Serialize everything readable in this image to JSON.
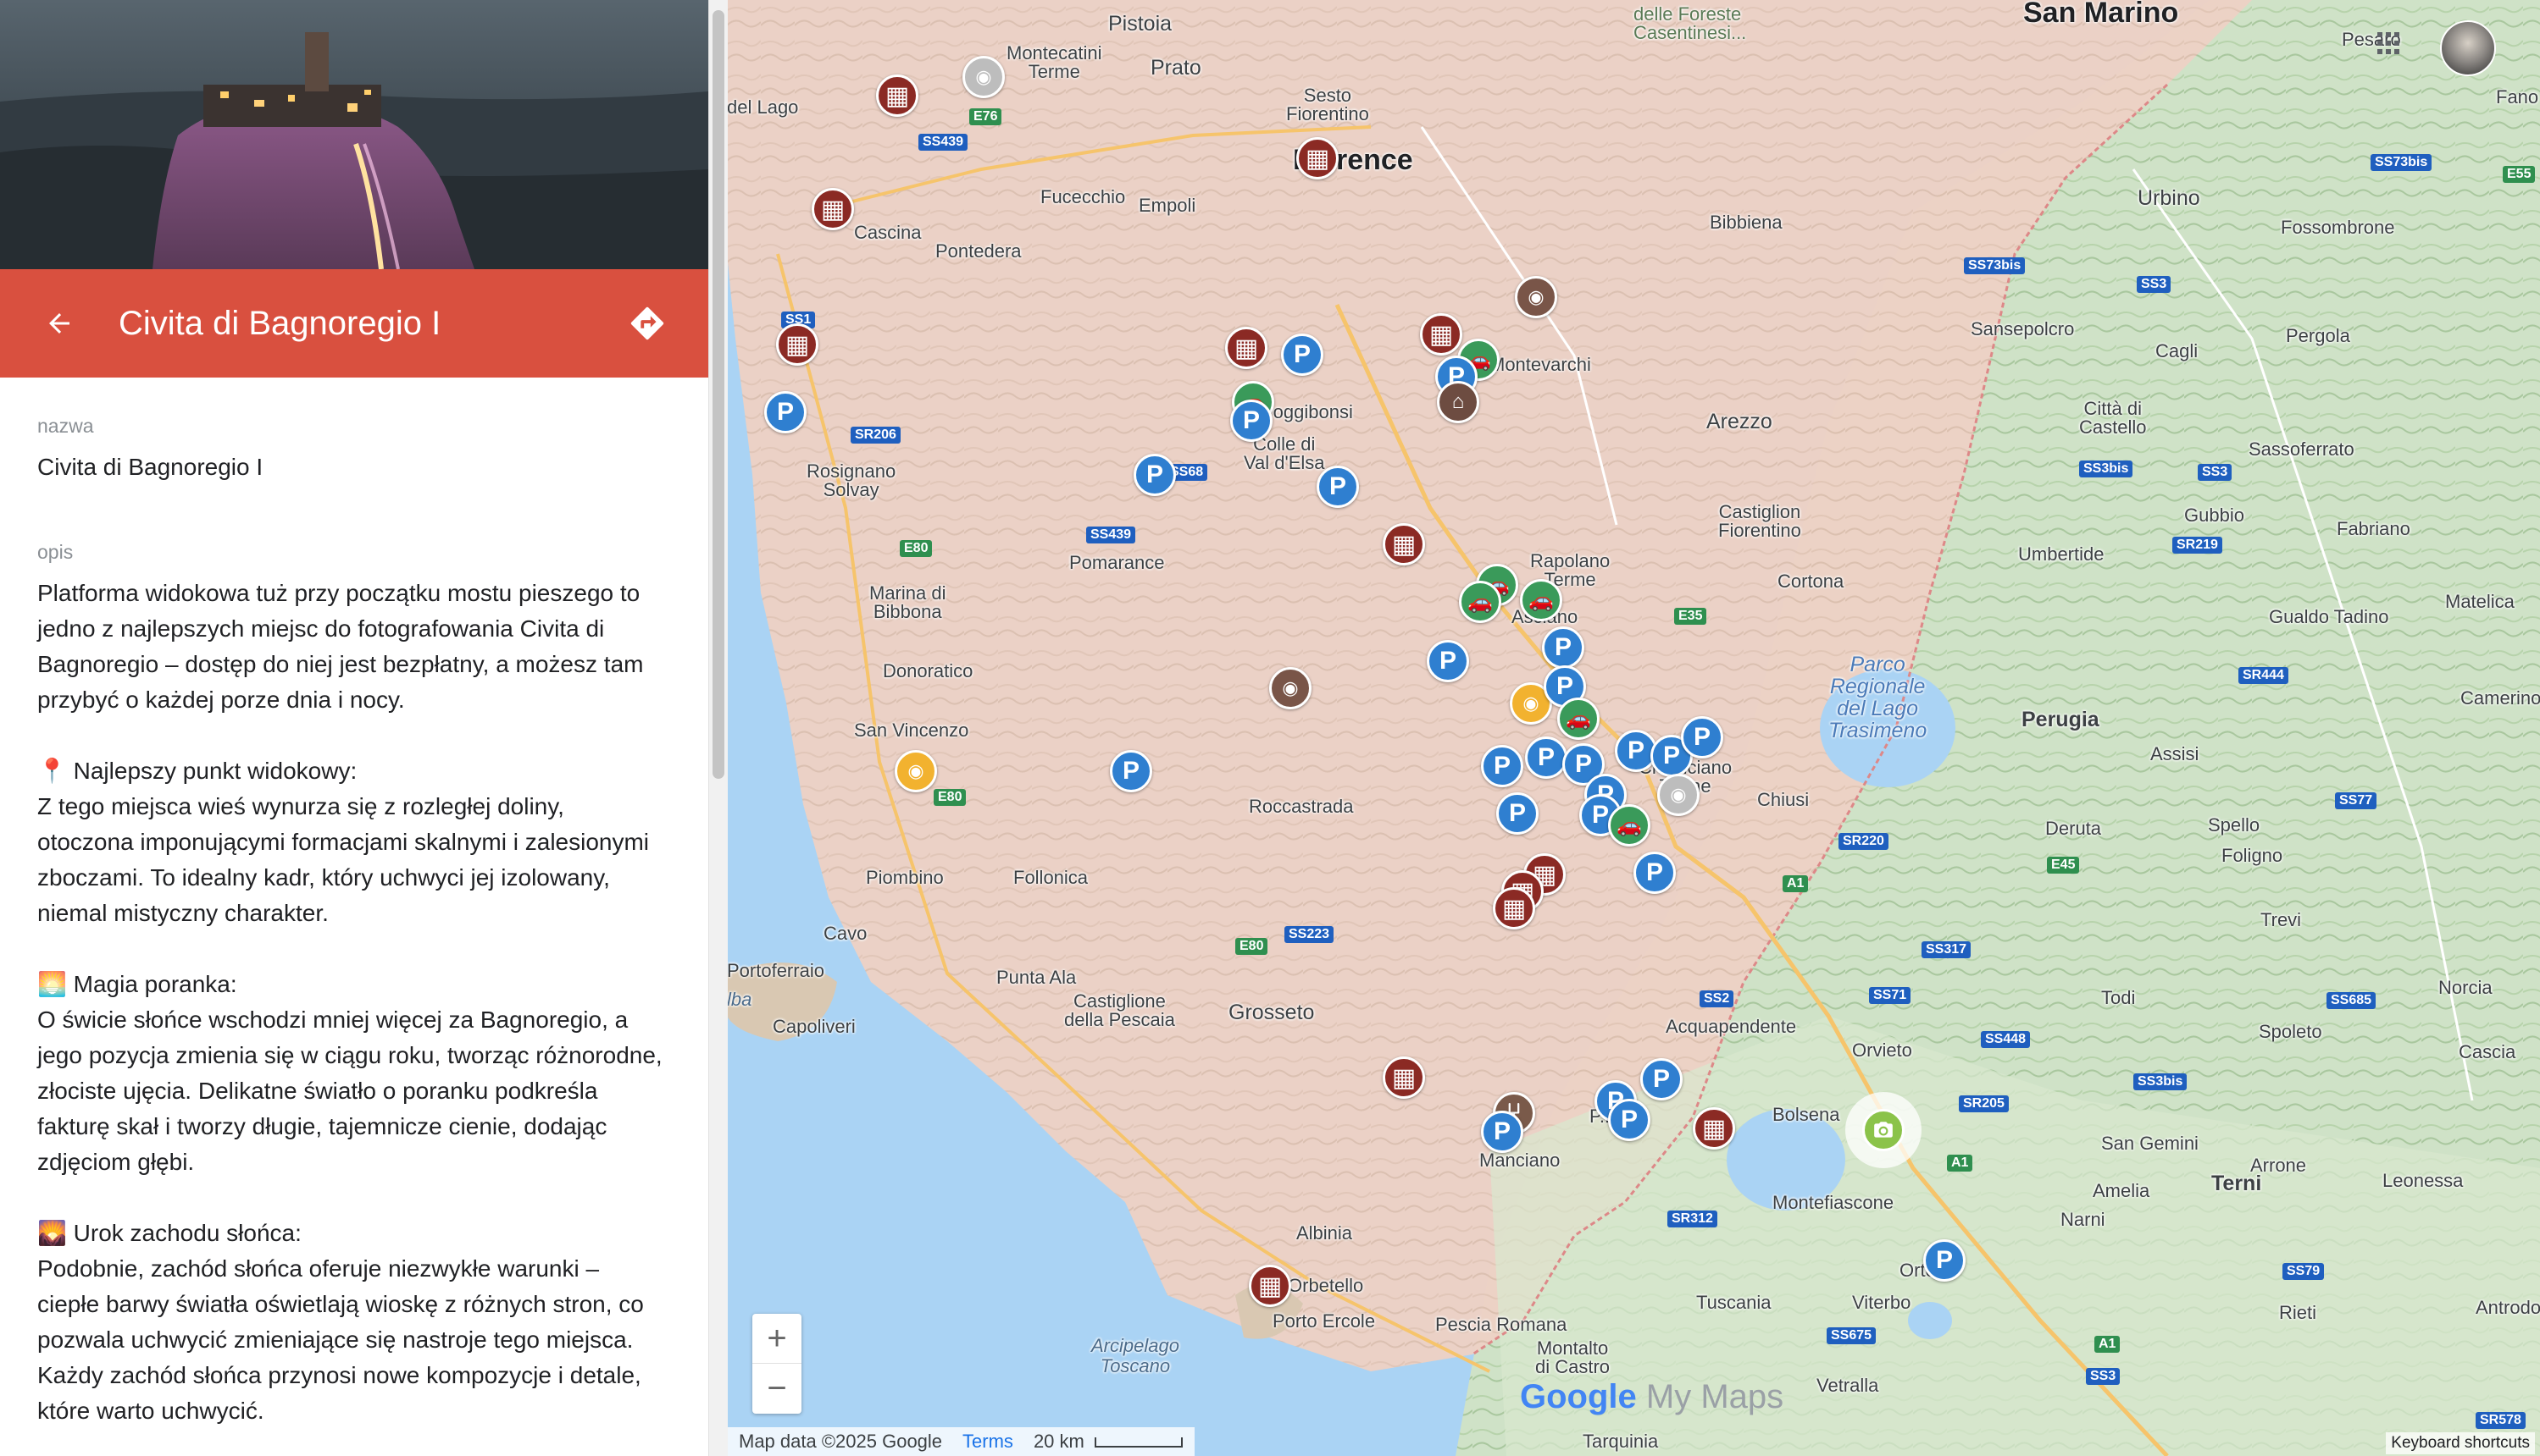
{
  "panel": {
    "title": "Civita di Bagnoregio I",
    "back_icon": "arrow-left-icon",
    "directions_icon": "directions-icon",
    "fields": {
      "name_label": "nazwa",
      "name_value": "Civita di Bagnoregio I",
      "desc_label": "opis",
      "desc_value": "Platforma widokowa tuż przy początku mostu pieszego to jedno z najlepszych miejsc do fotografowania Civita di Bagnoregio – dostęp do niej jest bezpłatny, a możesz tam przybyć o każdej porze dnia i nocy.\n\n📍 Najlepszy punkt widokowy:\nZ tego miejsca wieś wynurza się z rozległej doliny, otoczona imponującymi formacjami skalnymi i zalesionymi zboczami. To idealny kadr, który uchwyci jej izolowany, niemal mistyczny charakter.\n\n🌅 Magia poranka:\nO świcie słońce wschodzi mniej więcej za Bagnoregio, a jego pozycja zmienia się w ciągu roku, tworząc różnorodne, złociste ujęcia. Delikatne światło o poranku podkreśla fakturę skał i tworzy długie, tajemnicze cienie, dodając zdjęciom głębi.\n\n🌄 Urok zachodu słońca:\nPodobnie, zachód słońca oferuje niezwykłe warunki – ciepłe barwy światła oświetlają wioskę z różnych stron, co pozwala uchwycić zmieniające się nastroje tego miejsca. Każdy zachód słońca przynosi nowe kompozycje i detale, które warto uchwycić."
    },
    "colors": {
      "header": "#d9503f"
    }
  },
  "map": {
    "places": {
      "san_marino": "San Marino",
      "pistoia": "Pistoia",
      "prato": "Prato",
      "firenze": "Florence",
      "sesto": "Sesto\nFiorentino",
      "montecatini": "Montecatini\nTerme",
      "del_lago": "del Lago",
      "fucecchio": "Fucecchio",
      "empoli": "Empoli",
      "cascina": "Cascina",
      "pontedera": "Pontedera",
      "bibbiena": "Bibbiena",
      "foreste": "delle Foreste\nCasentinesi...",
      "urbino": "Urbino",
      "fano": "Fano",
      "pesaro": "Pesaro",
      "fossombrone": "Fossombrone",
      "pergola": "Pergola",
      "cagli": "Cagli",
      "sansepolcro": "Sansepolcro",
      "citta_castello": "Città di\nCastello",
      "sassoferrato": "Sassoferrato",
      "montevarchi": "Montevarchi",
      "arezzo": "Arezzo",
      "poggibonsi": "Poggibonsi",
      "colle": "Colle di\nVal d'Elsa",
      "rosignano": "Rosignano\nSolvay",
      "pomarance": "Pomarance",
      "castiglion": "Castiglion\nFiorentino",
      "rapolano": "Rapolano\nTerme",
      "cortona": "Cortona",
      "gubbio": "Gubbio",
      "umbertide": "Umbertide",
      "fabriano": "Fabriano",
      "gualdo": "Gualdo Tadino",
      "matelica": "Matelica",
      "marina_bibbona": "Marina di\nBibbona",
      "donoratico": "Donoratico",
      "asciano": "Asciano",
      "parco": "Parco\nRegionale\ndel Lago\nTrasimeno",
      "perugia": "Perugia",
      "assisi": "Assisi",
      "camerino": "Camerino",
      "san_vincenzo": "San Vincenzo",
      "roccastrada": "Roccastrada",
      "chiusi": "Chiusi",
      "deruta": "Deruta",
      "spello": "Spello",
      "foligno": "Foligno",
      "piombino": "Piombino",
      "follonica": "Follonica",
      "trevi": "Trevi",
      "cavo": "Cavo",
      "portoferraio": "Portoferraio",
      "capoliveri": "Capoliveri",
      "punta_ala": "Punta Ala",
      "castiglione": "Castiglione\ndella Pescaia",
      "grosseto": "Grosseto",
      "acquapendente": "Acquapendente",
      "todi": "Todi",
      "spoleto": "Spoleto",
      "norcia": "Norcia",
      "orvieto": "Orvieto",
      "cascia": "Cascia",
      "bolsena": "Bolsena",
      "san_gemini": "San Gemini",
      "manciano": "Manciano",
      "montefiascone": "Montefiascone",
      "amelia": "Amelia",
      "arrone": "Arrone",
      "leonessa": "Leonessa",
      "narni": "Narni",
      "terni": "Terni",
      "albinia": "Albinia",
      "orbetello": "Orbetello",
      "orte": "Orte",
      "porto_ercole": "Porto Ercole",
      "tuscania": "Tuscania",
      "viterbo": "Viterbo",
      "antrodoco": "Antrodoco",
      "arcipelago": "Arcipelago\nToscano",
      "pescia": "Pescia Romana",
      "montalto": "Montalto\ndi Castro",
      "vetralla": "Vetralla",
      "rieti": "Rieti",
      "tarquinia": "Tarquinia",
      "chianciano": "Chianciano\nTerme",
      "elba": "lba",
      "pitigliano": "P...ano"
    },
    "roads": [
      "SS439",
      "E76",
      "SS1",
      "SR206",
      "SS68",
      "SS439b",
      "E80",
      "E35",
      "SS73bis",
      "SS3",
      "SS3bis",
      "SR219",
      "SS73bis2",
      "SR444",
      "SS77",
      "SR220",
      "E45",
      "A1",
      "SS317",
      "SS71",
      "SS2",
      "SS448",
      "SS685",
      "SS3bis2",
      "SR205",
      "SS312",
      "SS675",
      "SS79",
      "SS3b",
      "SS578",
      "E80b",
      "SS223",
      "E80c"
    ],
    "road_labels": {
      "SS439": "SS439",
      "E76": "E76",
      "SS1": "SS1",
      "SR206": "SR206",
      "SS68": "SS68",
      "SS439b": "SS439",
      "E80": "E80",
      "E35": "E35",
      "SS73bis": "SS73bis",
      "SS3": "SS3",
      "SS3bis": "SS3bis",
      "SR219": "SR219",
      "SS73bis2": "SS73bis",
      "SR444": "SR444",
      "SS77": "SS77",
      "SR220": "SR220",
      "E45": "E45",
      "A1": "A1",
      "SS317": "SS317",
      "SS71": "SS71",
      "SS2": "SS2",
      "SS448": "SS448",
      "SS685": "SS685",
      "SS3bis2": "SS3bis",
      "SR205": "SR205",
      "SS312": "SR312",
      "SS675": "SS675",
      "SS79": "SS79",
      "SS3b": "SS3",
      "SS578": "SR578",
      "E80b": "E80",
      "SS223": "SS223",
      "E80c": "E80",
      "E55": "E55",
      "A1b": "A1",
      "A1c": "A1"
    },
    "controls": {
      "zoom_in": "+",
      "zoom_out": "−"
    },
    "logo": {
      "google": "Google",
      "mymaps": "My Maps"
    },
    "attribution": {
      "data": "Map data ©2025 Google",
      "terms": "Terms",
      "scale": "20 km"
    },
    "keyboard": "Keyboard shortcuts",
    "pin_glyphs": {
      "parking": "P"
    }
  }
}
